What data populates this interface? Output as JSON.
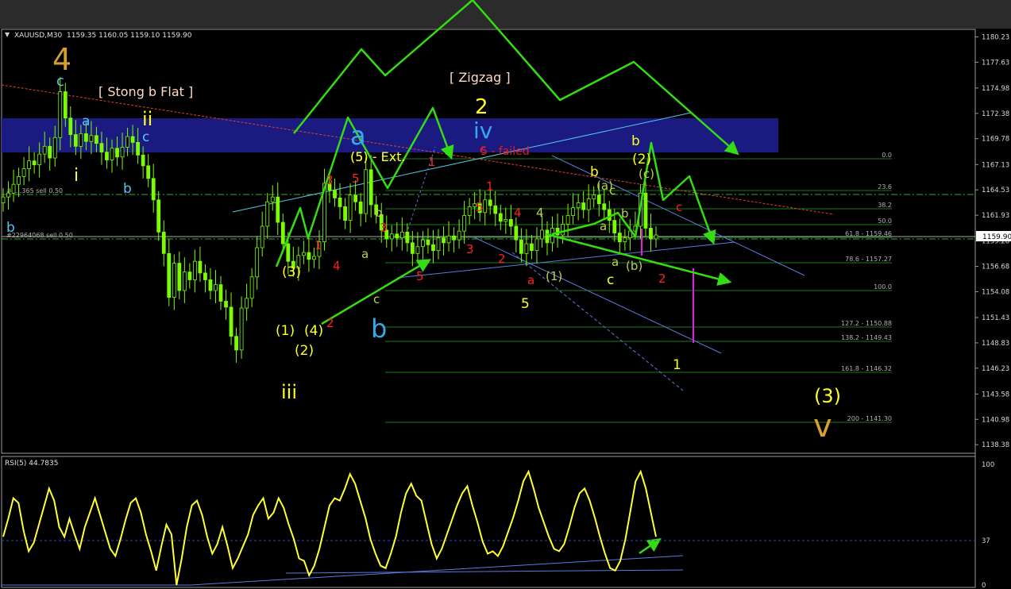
{
  "header": {
    "symbol": "XAUUSD,M30",
    "ohlc": "1159.35 1160.05 1159.10 1159.90"
  },
  "colors": {
    "candle": "#7CFC00",
    "zone": "#1c1c8c",
    "arrow": "#33dd11",
    "fib": "#1a7a1a",
    "rsi": "#ffff33",
    "channel": "#5a7ae0",
    "cyan_line": "#55c8e8",
    "red_trend": "#e04030",
    "magenta": "#e020e0"
  },
  "chart_data": [
    {
      "type": "line",
      "panel": "price",
      "ylim": [
        1137.5,
        1181.0
      ],
      "yticks": [
        "1180.23",
        "1177.63",
        "1174.98",
        "1172.38",
        "1169.78",
        "1167.13",
        "1164.53",
        "1161.93",
        "1159.28",
        "1156.68",
        "1154.08",
        "1151.43",
        "1148.83",
        "1146.23",
        "1143.58",
        "1140.98",
        "1138.38"
      ],
      "price_label": "1159.90",
      "price_line": 1159.9,
      "series": [
        {
          "values": [
            1163.8,
            1164.2,
            1165.1,
            1165.9,
            1166.7,
            1167.5,
            1167.1,
            1168.2,
            1169.0,
            1167.8,
            1169.9,
            1174.6,
            1171.9,
            1170.2,
            1169.0,
            1170.3,
            1169.5,
            1170.1,
            1169.3,
            1168.4,
            1167.6,
            1168.8,
            1167.9,
            1168.9,
            1170.0,
            1169.4,
            1168.1,
            1167.0,
            1165.7,
            1163.5,
            1160.2,
            1158.0,
            1153.5,
            1157.0,
            1154.2,
            1156.1,
            1155.3,
            1157.2,
            1156.0,
            1155.3,
            1154.2,
            1154.8,
            1153.1,
            1152.5,
            1149.5,
            1148.1,
            1152.4,
            1153.4,
            1155.6,
            1158.6,
            1160.8,
            1163.3,
            1163.8,
            1161.2,
            1159.0,
            1157.2,
            1156.5,
            1157.8,
            1158.1,
            1157.4,
            1157.7,
            1159.2,
            1165.2,
            1164.5,
            1163.7,
            1162.8,
            1161.4,
            1164.0,
            1163.3,
            1162.1,
            1166.6,
            1163.0,
            1162.0,
            1160.4,
            1159.5,
            1160.0,
            1159.6,
            1160.2,
            1159.1,
            1158.0,
            1158.7,
            1159.4,
            1158.9,
            1158.3,
            1159.6,
            1159.1,
            1159.8,
            1159.4,
            1160.3,
            1161.9,
            1162.8,
            1163.1,
            1162.2,
            1163.5,
            1162.9,
            1162.1,
            1161.3,
            1161.5,
            1160.8,
            1159.4,
            1158.0,
            1159.0,
            1158.3,
            1159.5,
            1160.4,
            1159.1,
            1160.6,
            1159.9,
            1161.0,
            1161.9,
            1162.7,
            1163.2,
            1162.5,
            1163.6,
            1164.0,
            1163.1,
            1162.5,
            1161.4,
            1160.1,
            1159.2,
            1159.6,
            1160.3,
            1160.8,
            1164.2,
            1160.6,
            1159.5,
            1159.9
          ]
        }
      ],
      "fib_levels": [
        "0.0",
        "23.6",
        "38.2",
        "50.0",
        "61.8 - 1159.46",
        "78.6 - 1157.27",
        "100.0",
        "127.2 - 1150.88",
        "138.2 - 1149.43",
        "161.8 - 1146.32",
        "200 - 1141.30"
      ],
      "order_lines": [
        "#2...365 sell 0.50",
        "#22964068 sell 0.50"
      ],
      "annotations": {
        "boxes": [
          "[ Stong b Flat ]",
          "[ Zigzag ]"
        ],
        "extension": "(5) - Ext.",
        "failed": "5 - failed",
        "waves": [
          "4",
          "c",
          "a",
          "i",
          "ii",
          "c",
          "b",
          "b",
          "iii",
          "(1)",
          "(2)",
          "(3)",
          "(4)",
          "a",
          "b",
          "(5)",
          "a",
          "b",
          "c",
          "5",
          "3",
          "4",
          "1",
          "2",
          "3",
          "5",
          "1",
          "2",
          "iv",
          "c",
          "5",
          "1",
          "2",
          "3",
          "4",
          "4",
          "a",
          "a",
          "5",
          "(1)",
          "b",
          "(a)",
          "c",
          "b",
          "a",
          "c",
          "(b)",
          "b",
          "(2)",
          "(c)",
          "c",
          "2",
          "1",
          "(3)",
          "v",
          "5"
        ]
      }
    },
    {
      "type": "line",
      "panel": "rsi",
      "title": "RSI(5) 44.7835",
      "ylim": [
        0,
        100
      ],
      "yticks": [
        "100",
        "37",
        "0"
      ],
      "level": 37,
      "series": [
        {
          "values": [
            40,
            55,
            72,
            68,
            45,
            28,
            35,
            50,
            65,
            80,
            70,
            48,
            40,
            55,
            42,
            30,
            48,
            60,
            72,
            58,
            44,
            30,
            24,
            38,
            54,
            68,
            72,
            60,
            42,
            28,
            12,
            32,
            50,
            42,
            0,
            22,
            48,
            66,
            70,
            58,
            40,
            26,
            34,
            48,
            32,
            14,
            22,
            32,
            42,
            58,
            66,
            72,
            55,
            60,
            72,
            64,
            50,
            38,
            22,
            20,
            8,
            16,
            30,
            48,
            66,
            72,
            70,
            80,
            92,
            84,
            70,
            56,
            38,
            26,
            16,
            14,
            26,
            40,
            60,
            76,
            84,
            74,
            70,
            52,
            34,
            22,
            30,
            42,
            54,
            66,
            76,
            82,
            66,
            52,
            36,
            26,
            28,
            24,
            32,
            44,
            56,
            70,
            86,
            94,
            80,
            64,
            52,
            40,
            30,
            28,
            34,
            48,
            64,
            76,
            80,
            70,
            56,
            40,
            26,
            14,
            12,
            20,
            38,
            62,
            86,
            94,
            80,
            60,
            40
          ]
        }
      ]
    }
  ]
}
